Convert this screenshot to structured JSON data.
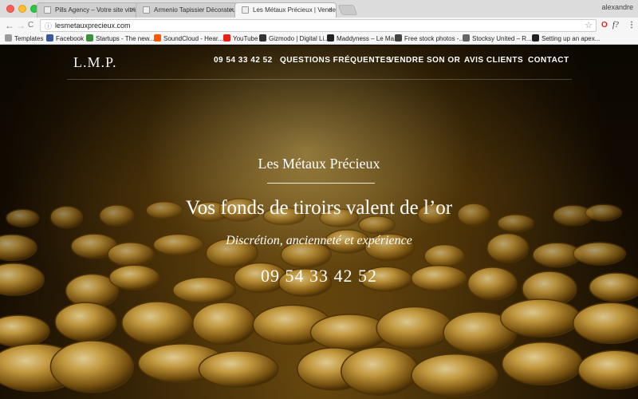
{
  "browser": {
    "tabs": [
      {
        "title": "Pills Agency – Votre site vitrine"
      },
      {
        "title": "Armenio Tapissier Décorateur"
      },
      {
        "title": "Les Métaux Précieux | Vendez"
      }
    ],
    "tab_close": "×",
    "user": "alexandre",
    "url": "lesmetauxprecieux.com",
    "back_icon": "←",
    "forward_icon": "→",
    "reload_icon": "C",
    "info_icon": "ⓘ",
    "star_icon": "☆",
    "ext_opera": "O",
    "ext_f": "f?",
    "menu_icon": "⋮"
  },
  "bookmarks": [
    {
      "label": "Templates",
      "color": "#9a9a9a"
    },
    {
      "label": "Facebook",
      "color": "#3b5998"
    },
    {
      "label": "Startups - The new...",
      "color": "#3d8f3d"
    },
    {
      "label": "SoundCloud - Hear...",
      "color": "#ff5500"
    },
    {
      "label": "YouTube",
      "color": "#e62117"
    },
    {
      "label": "Gizmodo | Digital Li...",
      "color": "#333333"
    },
    {
      "label": "Maddyness – Le Ma...",
      "color": "#222222"
    },
    {
      "label": "Free stock photos -...",
      "color": "#444444"
    },
    {
      "label": "Stocksy United – R...",
      "color": "#666666"
    },
    {
      "label": "Setting up an apex...",
      "color": "#222222"
    }
  ],
  "site": {
    "logo": "L.M.P.",
    "nav": [
      "09 54 33 42 52",
      "QUESTIONS FRÉQUENTES",
      "VENDRE SON OR",
      "AVIS CLIENTS",
      "CONTACT"
    ],
    "hero_name": "Les Métaux Précieux",
    "hero_title": "Vos fonds de tiroirs valent de l’or",
    "hero_subtitle": "Discrétion, ancienneté et expérience",
    "hero_phone": "09 54 33 42 52"
  },
  "colors": {
    "accent_gold": "#c9992f",
    "text": "#ffffff"
  }
}
